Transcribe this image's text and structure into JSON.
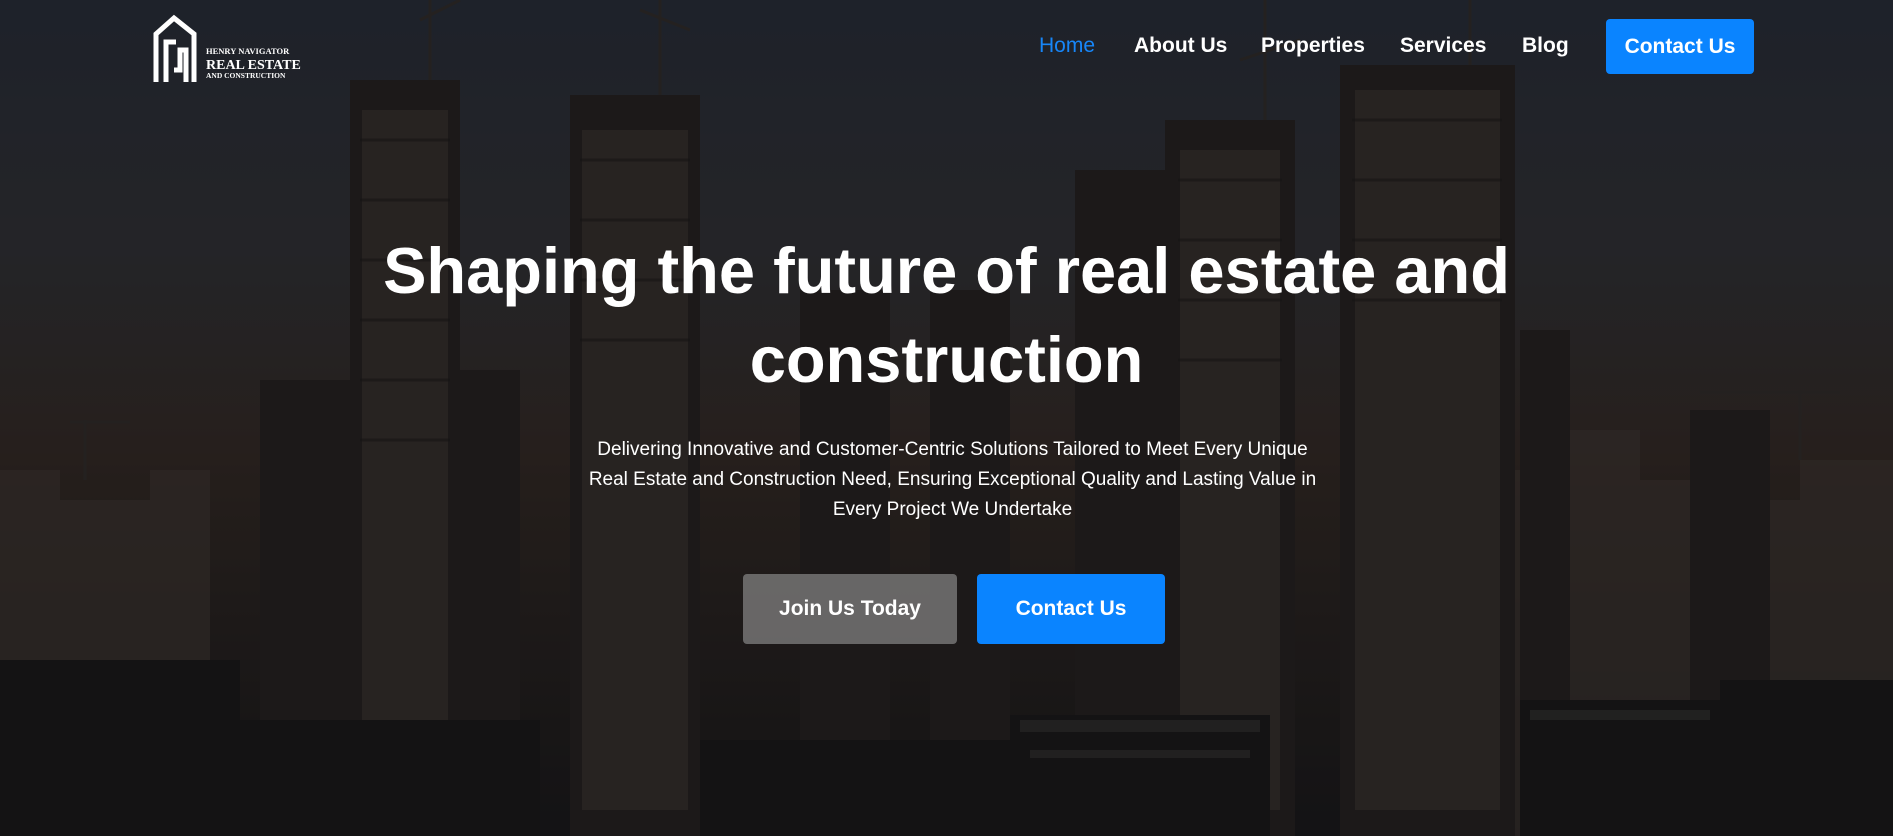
{
  "brand": {
    "logo_line1": "HENRY NAVIGATOR",
    "logo_line2": "REAL ESTATE",
    "logo_line3": "AND CONSTRUCTION"
  },
  "nav": {
    "items": [
      {
        "label": "Home",
        "active": true
      },
      {
        "label": "About Us",
        "active": false
      },
      {
        "label": "Properties",
        "active": false
      },
      {
        "label": "Services",
        "active": false
      },
      {
        "label": "Blog",
        "active": false
      }
    ],
    "cta_label": "Contact Us"
  },
  "hero": {
    "headline_line1": "Shaping the future of real estate and",
    "headline_line2": "construction",
    "subtitle_line1": "Delivering Innovative and Customer-Centric Solutions Tailored to Meet Every Unique",
    "subtitle_line2": "Real Estate and Construction Need, Ensuring Exceptional Quality and Lasting Value in",
    "subtitle_line3": "Every Project We Undertake",
    "primary_button": "Join Us Today",
    "secondary_button": "Contact Us"
  },
  "colors": {
    "accent": "#0a84ff",
    "active_link": "#1786f8",
    "text": "#ffffff"
  },
  "icons": [
    "logo-building-icon"
  ]
}
